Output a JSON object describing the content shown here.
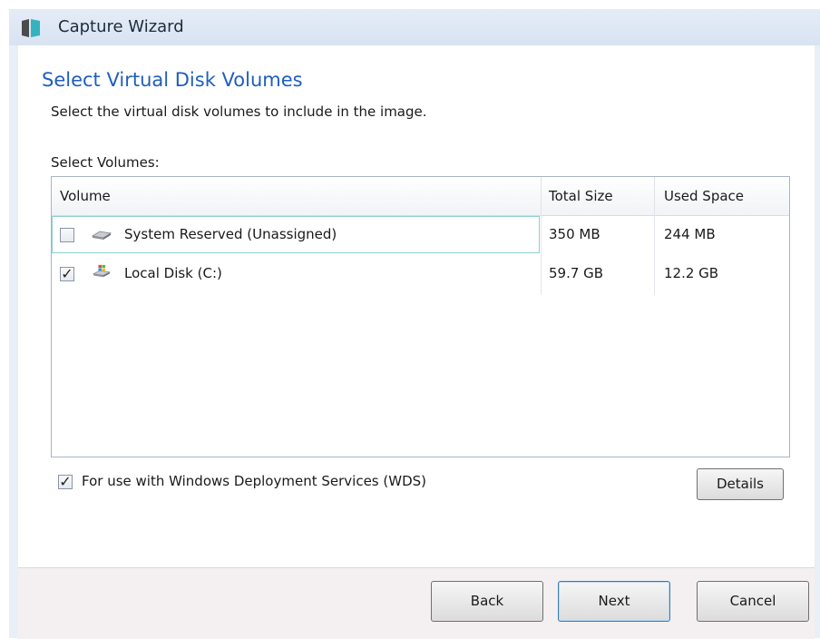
{
  "window": {
    "title": "Capture Wizard"
  },
  "page": {
    "heading": "Select Virtual Disk Volumes",
    "subheading": "Select the virtual disk volumes to include in the image.",
    "volumes_label": "Select Volumes:"
  },
  "table": {
    "columns": [
      "Volume",
      "Total Size",
      "Used Space"
    ],
    "rows": [
      {
        "checked": false,
        "check_glyph": "",
        "icon": "drive-icon",
        "volume": "System Reserved  (Unassigned)",
        "total_size": "350 MB",
        "used_space": "244 MB"
      },
      {
        "checked": true,
        "check_glyph": "✓",
        "icon": "windows-drive-icon",
        "volume": "Local Disk  (C:)",
        "total_size": "59.7 GB",
        "used_space": "12.2 GB"
      }
    ]
  },
  "wds": {
    "checked": true,
    "check_glyph": "✓",
    "label": "For use with Windows Deployment Services (WDS)"
  },
  "buttons": {
    "details": "Details",
    "back": "Back",
    "next": "Next",
    "cancel": "Cancel"
  },
  "colors": {
    "heading": "#1f5ebf",
    "titlebar": "#dde6f3",
    "selection_border": "#8ecfd2"
  }
}
